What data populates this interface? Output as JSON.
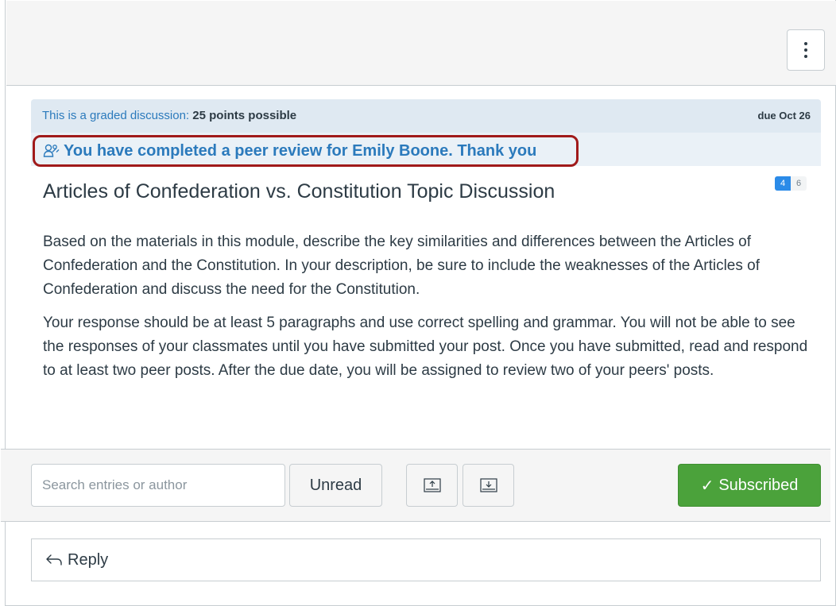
{
  "discussion": {
    "graded_label": "This is a graded discussion:",
    "points": "25 points possible",
    "due": "due Oct 26",
    "peer_review_notice": "You have completed a peer review for Emily Boone. Thank you",
    "title": "Articles of Confederation vs. Constitution Topic Discussion",
    "unread_count": "4",
    "total_count": "6",
    "paragraphs": [
      "Based on the materials in this module, describe the key similarities and differences between the Articles of Confederation and the Constitution. In your description, be sure to include the weaknesses of the Articles of Confederation and discuss the need for the Constitution.",
      "Your response should be at least 5 paragraphs and use correct spelling and grammar. You will not be able to see the responses of your classmates until you have submitted your post. Once you have submitted, read and respond to at least two peer posts. After the due date, you will be assigned to review two of your peers' posts."
    ]
  },
  "toolbar": {
    "search_placeholder": "Search entries or author",
    "unread_label": "Unread",
    "subscribed_label": "Subscribed"
  },
  "reply": {
    "label": "Reply"
  },
  "colors": {
    "accent_blue": "#2b7abc",
    "success_green": "#4ba23b",
    "highlight_border": "#a01a1a"
  },
  "icons": {
    "options": "kebab-menu-icon",
    "peer_review": "peer-review-icon",
    "collapse": "collapse-up-icon",
    "expand": "expand-down-icon",
    "check": "checkmark-icon",
    "reply": "reply-arrow-icon"
  }
}
